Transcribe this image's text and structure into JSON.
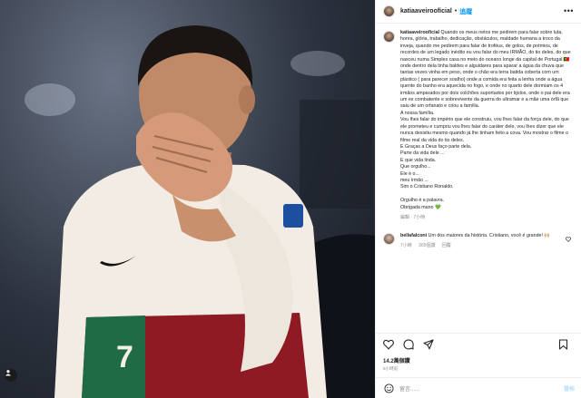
{
  "post": {
    "username": "katiaaveirooficial",
    "follow_label": "追蹤",
    "more_label": "•••",
    "caption_user": "katiaaveirooficial",
    "caption": "Quando os meus netos me pedirem para falar sobre luta, honra, glória, trabalho, dedicação, obstáculos, maldade humana a troco da inveja, quando me pedirem para falar de troféus, de golos, de prémios, de recordes de um legado inédito eu vou falar do meu IRMÃO, do tio deles, do que nasceu numa Simples casa no meio do oceano longe da capital de Portugal 🇵🇹 onde dentro dela tinha baldes e alguidares para aparar a água da chuva que tantas vezes vinha em peso, onde o chão era terra batida coberta com um plástico ( para parecer soalho) onde a comida era feita a lenha onde a água quente do banho era aquecida no fogo, e onde no quarto dele dormiam os 4 irmãos amparados por dois colchões suportados por tijolos, onde o pai dele era um ex combatente e sobrevivente da guerra do ultramar e a mãe uma órfã que saiu de um orfanato e criou a família.\nA nossa família.\nVou lhes falar do império que ele construiu, vou lhes falar da força dele, do que ele prometeu e cumpriu vou lhes falar do caráter dele, vou lhes dizer que ele nunca desistiu mesmo quando já lhe tinham feito a cova. Vou mostrar o filme o filme real da vida do tio deles.\nE Graças a Deus faço parte dela.\nParte da vida dele ...\nE que vida linda.\nQue orgulho...\nEle é o...\nmeu irmão ...\nSim o Cristiano Ronaldo.\n\nOrgulho é a palavra.\nObrigada mano 💚",
    "caption_meta": "編輯 · 7小時",
    "comment_user": "bellafalconi",
    "comment_text": "Um dos maiores da história. Cristiano, você é grande! 🙌🏼",
    "comment_time": "7小時",
    "comment_likes": "365個讚",
    "comment_reply": "回覆",
    "likes": "14.2萬個讚",
    "date": "8小時前",
    "add_placeholder": "留言......",
    "post_label": "發佈"
  },
  "photo": {
    "jersey_number": "7"
  }
}
